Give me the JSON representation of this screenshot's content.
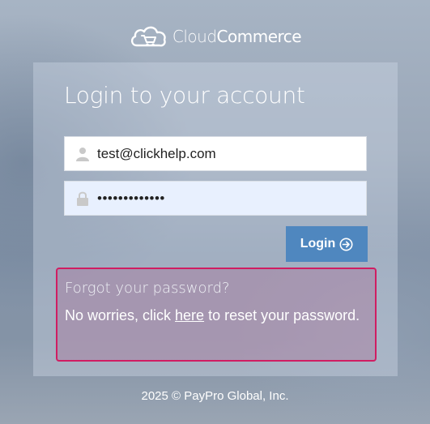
{
  "brand": {
    "name_light": "Cloud",
    "name_bold": "Commerce",
    "logo_icon": "cloud-cart-icon"
  },
  "login": {
    "title": "Login to your account",
    "email": {
      "value": "test@clickhelp.com",
      "icon": "user-icon"
    },
    "password": {
      "value": "•••••••••••••",
      "icon": "lock-icon"
    },
    "button": {
      "label": "Login",
      "icon": "arrow-circle-right-icon",
      "color": "#4f87bf"
    }
  },
  "forgot": {
    "title": "Forgot your password?",
    "text_before": "No worries, click ",
    "link": "here",
    "text_after": " to reset your password.",
    "highlight_color": "#d01d62"
  },
  "footer": {
    "copyright": "2025 © PayPro Global, Inc."
  }
}
